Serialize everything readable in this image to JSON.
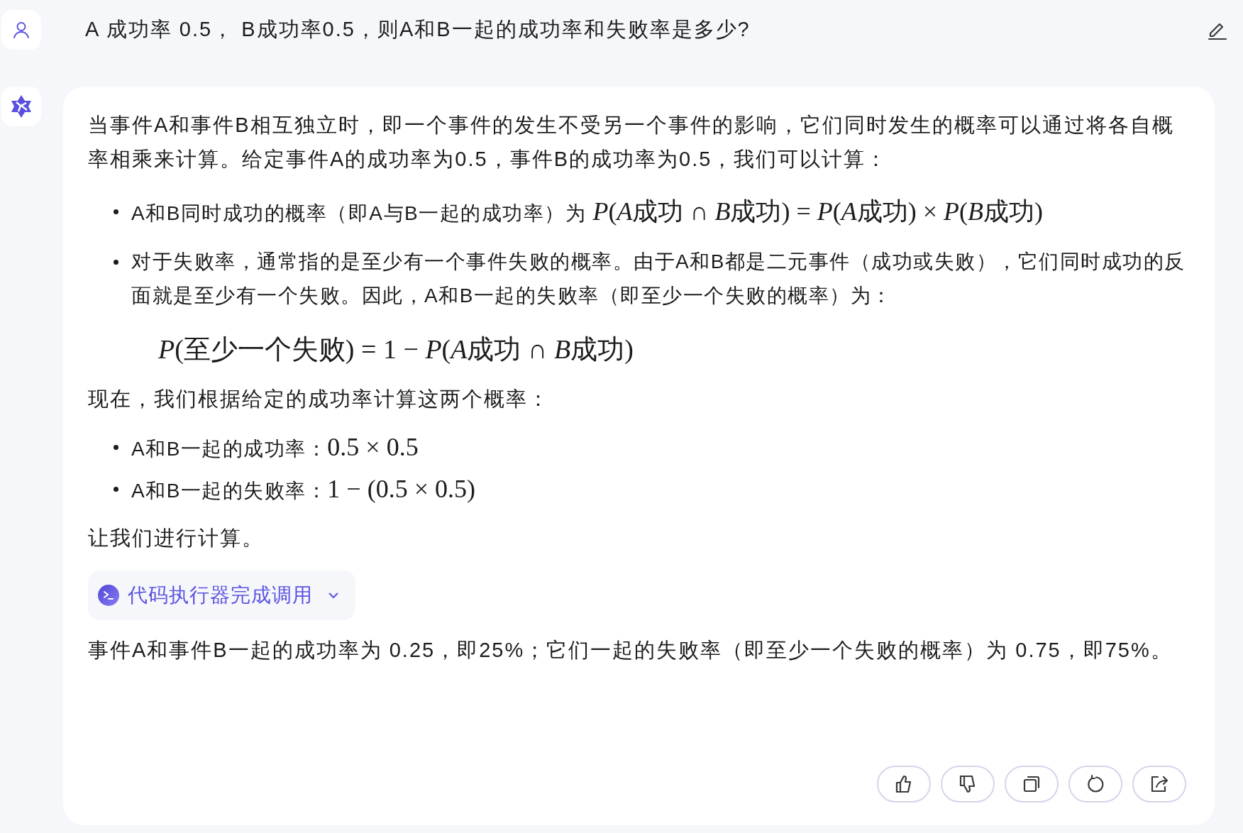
{
  "question": {
    "text": "A 成功率 0.5， B成功率0.5，则A和B一起的成功率和失败率是多少?"
  },
  "answer": [
    {
      "kind": "paragraph",
      "text": "当事件A和事件B相互独立时，即一个事件的发生不受另一个事件的影响，它们同时发生的概率可以通过将各自概率相乘来计算。给定事件A的成功率为0.5，事件B的成功率为0.5，我们可以计算："
    },
    {
      "kind": "bullets",
      "items": [
        {
          "text": "A和B同时成功的概率（即A与B一起的成功率）为 ",
          "math": "P(A成功 ∩ B成功) = P(A成功) × P(B成功)"
        },
        {
          "text": "对于失败率，通常指的是至少有一个事件失败的概率。由于A和B都是二元事件（成功或失败），它们同时成功的反面就是至少有一个失败。因此，A和B一起的失败率（即至少一个失败的概率）为："
        }
      ]
    },
    {
      "kind": "formula",
      "math": "P(至少一个失败) = 1 − P(A成功 ∩ B成功)"
    },
    {
      "kind": "paragraph",
      "text": "现在，我们根据给定的成功率计算这两个概率："
    },
    {
      "kind": "bullets",
      "items": [
        {
          "text": "A和B一起的成功率：",
          "math": "0.5 × 0.5"
        },
        {
          "text": "A和B一起的失败率：",
          "math": "1 − (0.5 × 0.5)"
        }
      ]
    },
    {
      "kind": "paragraph",
      "text": "让我们进行计算。"
    },
    {
      "kind": "tool_call",
      "label": "代码执行器完成调用",
      "expanded": false
    },
    {
      "kind": "paragraph",
      "text": "事件A和事件B一起的成功率为 0.25，即25%；它们一起的失败率（即至少一个失败的概率）为 0.75，即75%。"
    }
  ]
}
